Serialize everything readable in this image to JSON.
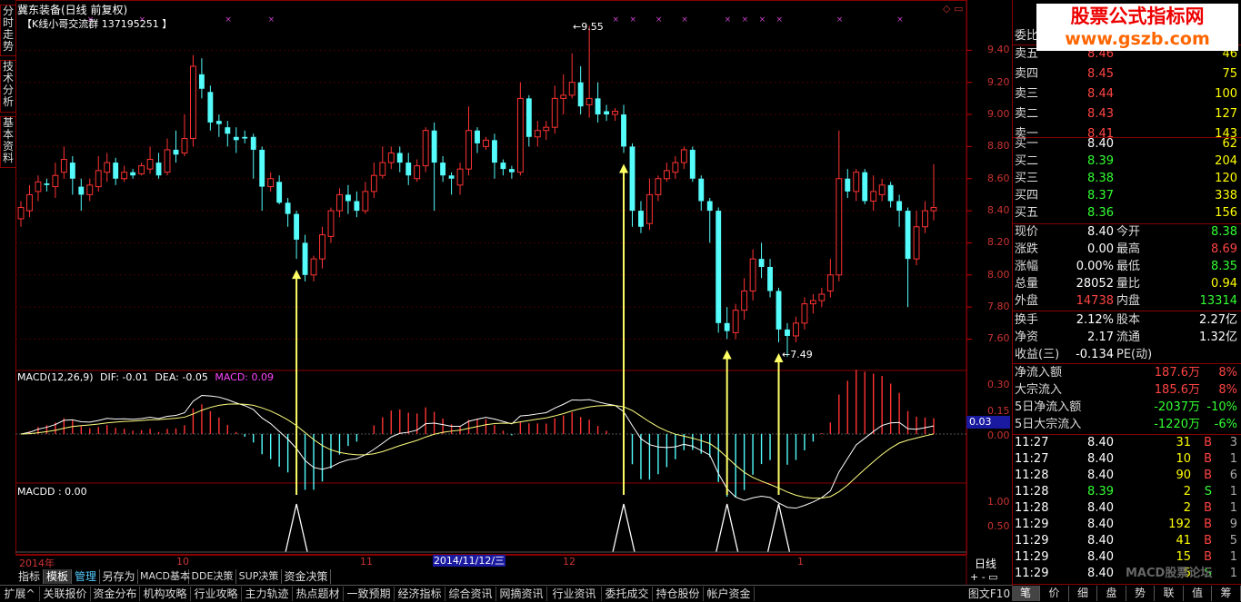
{
  "header": {
    "title": "冀东装备(日线 前复权)",
    "group": "【K线小哥交流群  137195251 】"
  },
  "side_tabs": [
    {
      "label": "分时走势"
    },
    {
      "label": "技术分析"
    },
    {
      "label": "基本资料"
    }
  ],
  "price_axis": [
    "9.40",
    "9.20",
    "9.00",
    "8.80",
    "8.60",
    "8.40",
    "8.20",
    "8.00",
    "7.80",
    "7.60"
  ],
  "annotations": {
    "high": "9.55",
    "low": "7.49"
  },
  "macd": {
    "label": "MACD(12,26,9)",
    "dif": "DIF: -0.01",
    "dea": "DEA: -0.05",
    "macd": "MACD: 0.09",
    "axis": [
      "0.30",
      "0.15",
      "0.00"
    ],
    "current": "0.03"
  },
  "macdd": {
    "label": "MACDD : 0.00",
    "axis": [
      "1.00",
      "0.50"
    ]
  },
  "time_axis": {
    "labels": [
      "2014年",
      "10",
      "11",
      "12",
      "1"
    ],
    "cursor": "2014/11/12/三",
    "period": "日线"
  },
  "bottom_tabs1": [
    "指标",
    "模板",
    "管理",
    "另存为",
    "MACD基本",
    "DDE决策",
    "SUP决策",
    "资金决策"
  ],
  "bottom_tabs2": [
    "扩展^",
    "关联报价",
    "资金分布",
    "机构攻略",
    "行业攻略",
    "主力轨迹",
    "热点题材",
    "一致预期",
    "经济指标",
    "综合资讯",
    "网摘资讯",
    "行业资讯",
    "委托成交",
    "持仓股份",
    "帐户资金"
  ],
  "bottom_right": "图文F10",
  "watermark": {
    "line1": "股票公式指标网",
    "line2": "www.gszb.com",
    "bbs": "MACD股票论坛"
  },
  "orderbook": {
    "header": "委比",
    "asks": [
      {
        "label": "卖五",
        "price": "8.46",
        "vol": "46"
      },
      {
        "label": "卖四",
        "price": "8.45",
        "vol": "75"
      },
      {
        "label": "卖三",
        "price": "8.44",
        "vol": "100"
      },
      {
        "label": "卖二",
        "price": "8.43",
        "vol": "127"
      },
      {
        "label": "卖一",
        "price": "8.41",
        "vol": "143"
      }
    ],
    "bids": [
      {
        "label": "买一",
        "price": "8.40",
        "vol": "62"
      },
      {
        "label": "买二",
        "price": "8.39",
        "vol": "204"
      },
      {
        "label": "买三",
        "price": "8.38",
        "vol": "120"
      },
      {
        "label": "买四",
        "price": "8.37",
        "vol": "338"
      },
      {
        "label": "买五",
        "price": "8.36",
        "vol": "156"
      }
    ]
  },
  "quote": [
    {
      "l1": "现价",
      "v1": "8.40",
      "l2": "今开",
      "v2": "8.38"
    },
    {
      "l1": "涨跌",
      "v1": "0.00",
      "l2": "最高",
      "v2": "8.69"
    },
    {
      "l1": "涨幅",
      "v1": "0.00%",
      "l2": "最低",
      "v2": "8.35"
    },
    {
      "l1": "总量",
      "v1": "28052",
      "l2": "量比",
      "v2": "0.94"
    },
    {
      "l1": "外盘",
      "v1": "14738",
      "l2": "内盘",
      "v2": "13314"
    },
    {
      "l1": "换手",
      "v1": "2.12%",
      "l2": "股本",
      "v2": "2.27亿"
    },
    {
      "l1": "净资",
      "v1": "2.17",
      "l2": "流通",
      "v2": "1.32亿"
    },
    {
      "l1": "收益(三)",
      "v1": "-0.134",
      "l2": "PE(动)",
      "v2": ""
    }
  ],
  "flows": [
    {
      "label": "净流入额",
      "value": "187.6万",
      "pct": "8%"
    },
    {
      "label": "大宗流入",
      "value": "185.6万",
      "pct": "8%"
    },
    {
      "label": "5日净流入额",
      "value": "-2037万",
      "pct": "-10%"
    },
    {
      "label": "5日大宗流入",
      "value": "-1220万",
      "pct": "-6%"
    }
  ],
  "ticks": [
    {
      "t": "11:27",
      "p": "8.40",
      "v": "31",
      "s": "B",
      "n": "3"
    },
    {
      "t": "11:27",
      "p": "8.40",
      "v": "10",
      "s": "B",
      "n": "1"
    },
    {
      "t": "11:28",
      "p": "8.40",
      "v": "90",
      "s": "B",
      "n": "6"
    },
    {
      "t": "11:28",
      "p": "8.39",
      "v": "2",
      "s": "S",
      "n": "1"
    },
    {
      "t": "11:28",
      "p": "8.40",
      "v": "2",
      "s": "B",
      "n": "1"
    },
    {
      "t": "11:29",
      "p": "8.40",
      "v": "192",
      "s": "B",
      "n": "9"
    },
    {
      "t": "11:29",
      "p": "8.40",
      "v": "41",
      "s": "B",
      "n": "5"
    },
    {
      "t": "11:29",
      "p": "8.40",
      "v": "15",
      "s": "B",
      "n": "1"
    },
    {
      "t": "11:29",
      "p": "8.40",
      "v": "5",
      "s": "S",
      "n": "1"
    }
  ],
  "right_tabs": [
    "笔",
    "价",
    "细",
    "盘",
    "势",
    "联",
    "值",
    "筹"
  ],
  "colors": {
    "up": "#ff3333",
    "down": "#54fcfc",
    "axis": "#cc0000",
    "ma": "#ffff80"
  },
  "chart_data": {
    "type": "candlestick",
    "ylim": [
      7.45,
      9.6
    ],
    "candles": [
      [
        8.35,
        8.42,
        8.3,
        8.46
      ],
      [
        8.4,
        8.5,
        8.36,
        8.56
      ],
      [
        8.52,
        8.58,
        8.46,
        8.62
      ],
      [
        8.57,
        8.56,
        8.52,
        8.6
      ],
      [
        8.55,
        8.62,
        8.48,
        8.7
      ],
      [
        8.64,
        8.72,
        8.6,
        8.8
      ],
      [
        8.7,
        8.6,
        8.5,
        8.74
      ],
      [
        8.55,
        8.5,
        8.4,
        8.6
      ],
      [
        8.5,
        8.56,
        8.46,
        8.6
      ],
      [
        8.55,
        8.65,
        8.52,
        8.74
      ],
      [
        8.64,
        8.7,
        8.58,
        8.76
      ],
      [
        8.7,
        8.6,
        8.56,
        8.73
      ],
      [
        8.6,
        8.64,
        8.58,
        8.68
      ],
      [
        8.64,
        8.62,
        8.6,
        8.66
      ],
      [
        8.63,
        8.68,
        8.62,
        8.7
      ],
      [
        8.66,
        8.72,
        8.63,
        8.8
      ],
      [
        8.7,
        8.62,
        8.6,
        8.76
      ],
      [
        8.64,
        8.78,
        8.62,
        8.85
      ],
      [
        8.78,
        8.75,
        8.7,
        8.9
      ],
      [
        8.76,
        8.85,
        8.74,
        9.0
      ],
      [
        8.85,
        9.3,
        8.8,
        9.37
      ],
      [
        9.25,
        9.16,
        9.1,
        9.35
      ],
      [
        9.14,
        8.95,
        8.9,
        9.18
      ],
      [
        8.96,
        8.94,
        8.86,
        9.0
      ],
      [
        8.92,
        8.88,
        8.8,
        8.96
      ],
      [
        8.86,
        8.84,
        8.76,
        8.92
      ],
      [
        8.86,
        8.85,
        8.82,
        8.9
      ],
      [
        8.86,
        8.78,
        8.6,
        8.88
      ],
      [
        8.78,
        8.55,
        8.4,
        8.8
      ],
      [
        8.55,
        8.6,
        8.52,
        8.64
      ],
      [
        8.58,
        8.45,
        8.44,
        8.62
      ],
      [
        8.45,
        8.38,
        8.3,
        8.48
      ],
      [
        8.38,
        8.22,
        8.1,
        8.4
      ],
      [
        8.2,
        8.0,
        7.96,
        8.25
      ],
      [
        8.0,
        8.1,
        7.96,
        8.12
      ],
      [
        8.1,
        8.25,
        8.04,
        8.3
      ],
      [
        8.24,
        8.4,
        8.2,
        8.42
      ],
      [
        8.4,
        8.5,
        8.36,
        8.54
      ],
      [
        8.5,
        8.46,
        8.38,
        8.56
      ],
      [
        8.46,
        8.4,
        8.36,
        8.52
      ],
      [
        8.4,
        8.52,
        8.38,
        8.58
      ],
      [
        8.52,
        8.62,
        8.48,
        8.7
      ],
      [
        8.62,
        8.7,
        8.6,
        8.8
      ],
      [
        8.7,
        8.76,
        8.66,
        8.8
      ],
      [
        8.76,
        8.7,
        8.64,
        8.8
      ],
      [
        8.7,
        8.62,
        8.56,
        8.76
      ],
      [
        8.6,
        8.68,
        8.58,
        8.72
      ],
      [
        8.68,
        8.9,
        8.64,
        8.92
      ],
      [
        8.9,
        8.7,
        8.4,
        8.95
      ],
      [
        8.7,
        8.62,
        8.58,
        8.74
      ],
      [
        8.62,
        8.6,
        8.5,
        8.64
      ],
      [
        8.56,
        8.66,
        8.5,
        8.7
      ],
      [
        8.66,
        8.9,
        8.62,
        9.05
      ],
      [
        8.9,
        8.82,
        8.76,
        8.92
      ],
      [
        8.8,
        8.84,
        8.78,
        8.86
      ],
      [
        8.84,
        8.7,
        8.6,
        8.88
      ],
      [
        8.7,
        8.66,
        8.62,
        8.72
      ],
      [
        8.66,
        8.64,
        8.6,
        8.68
      ],
      [
        8.64,
        9.1,
        8.62,
        9.2
      ],
      [
        9.1,
        8.86,
        8.8,
        9.12
      ],
      [
        8.86,
        8.9,
        8.8,
        8.96
      ],
      [
        8.9,
        8.92,
        8.84,
        8.96
      ],
      [
        8.92,
        9.1,
        8.88,
        9.18
      ],
      [
        9.1,
        9.12,
        9.0,
        9.25
      ],
      [
        9.12,
        9.2,
        9.1,
        9.38
      ],
      [
        9.2,
        9.05,
        9.0,
        9.3
      ],
      [
        9.06,
        9.1,
        8.98,
        9.55
      ],
      [
        9.1,
        9.0,
        8.95,
        9.2
      ],
      [
        9.02,
        9.0,
        8.96,
        9.06
      ],
      [
        9.0,
        9.02,
        8.96,
        9.04
      ],
      [
        9.0,
        8.8,
        8.76,
        9.06
      ],
      [
        8.8,
        8.4,
        8.3,
        8.82
      ],
      [
        8.4,
        8.3,
        8.26,
        8.46
      ],
      [
        8.32,
        8.5,
        8.28,
        8.6
      ],
      [
        8.5,
        8.6,
        8.46,
        8.62
      ],
      [
        8.6,
        8.65,
        8.58,
        8.7
      ],
      [
        8.64,
        8.7,
        8.6,
        8.74
      ],
      [
        8.7,
        8.78,
        8.66,
        8.8
      ],
      [
        8.78,
        8.6,
        8.58,
        8.8
      ],
      [
        8.6,
        8.46,
        8.4,
        8.62
      ],
      [
        8.46,
        8.4,
        8.2,
        8.48
      ],
      [
        8.4,
        7.7,
        7.64,
        8.42
      ],
      [
        7.7,
        7.65,
        7.6,
        7.8
      ],
      [
        7.64,
        7.78,
        7.6,
        7.82
      ],
      [
        7.78,
        7.9,
        7.72,
        7.98
      ],
      [
        7.9,
        8.1,
        7.84,
        8.16
      ],
      [
        8.1,
        8.05,
        7.98,
        8.2
      ],
      [
        8.05,
        7.9,
        7.86,
        8.1
      ],
      [
        7.9,
        7.66,
        7.58,
        7.92
      ],
      [
        7.66,
        7.62,
        7.49,
        7.7
      ],
      [
        7.62,
        7.7,
        7.58,
        7.74
      ],
      [
        7.7,
        7.82,
        7.66,
        7.86
      ],
      [
        7.82,
        7.84,
        7.76,
        7.88
      ],
      [
        7.84,
        7.88,
        7.8,
        7.92
      ],
      [
        7.9,
        8.0,
        7.86,
        8.1
      ],
      [
        8.0,
        8.6,
        7.96,
        8.9
      ],
      [
        8.6,
        8.52,
        8.48,
        8.66
      ],
      [
        8.52,
        8.64,
        8.46,
        8.66
      ],
      [
        8.64,
        8.46,
        8.44,
        8.66
      ],
      [
        8.46,
        8.52,
        8.4,
        8.62
      ],
      [
        8.5,
        8.56,
        8.46,
        8.6
      ],
      [
        8.56,
        8.46,
        8.42,
        8.58
      ],
      [
        8.46,
        8.4,
        8.3,
        8.5
      ],
      [
        8.4,
        8.1,
        7.8,
        8.42
      ],
      [
        8.1,
        8.3,
        8.06,
        8.4
      ],
      [
        8.3,
        8.4,
        8.26,
        8.46
      ],
      [
        8.4,
        8.42,
        8.34,
        8.69
      ]
    ],
    "signals": [
      32,
      70,
      82,
      88
    ]
  }
}
